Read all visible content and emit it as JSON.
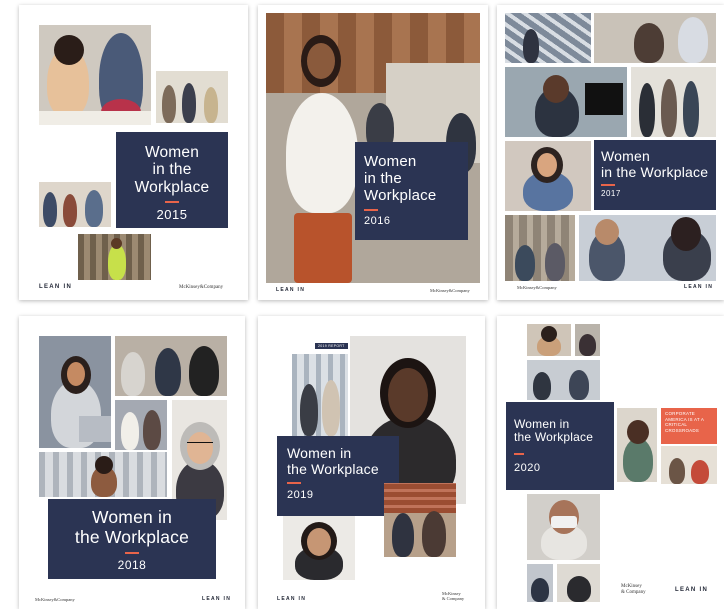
{
  "covers": [
    {
      "title": "Women\nin the\nWorkplace",
      "year": "2015",
      "lean_in": "LEAN IN",
      "mckinsey": "McKinsey&Company"
    },
    {
      "title": "Women\nin the\nWorkplace",
      "year": "2016",
      "lean_in": "LEAN IN",
      "mckinsey": "McKinsey&Company"
    },
    {
      "title": "Women\nin the Workplace",
      "year": "2017",
      "lean_in": "LEAN IN",
      "mckinsey": "McKinsey&Company"
    },
    {
      "title": "Women in\nthe Workplace",
      "year": "2018",
      "lean_in": "LEAN IN",
      "mckinsey": "McKinsey&Company"
    },
    {
      "title": "Women in\nthe Workplace",
      "year": "2019",
      "lean_in": "LEAN IN",
      "mckinsey": "McKinsey\n& Company",
      "tag": "2019 REPORT"
    },
    {
      "title": "Women in\nthe Workplace",
      "year": "2020",
      "lean_in": "LEAN IN",
      "mckinsey": "McKinsey\n& Company",
      "tag": "CORPORATE AMERICA IS AT A CRITICAL CROSSROADS"
    }
  ],
  "colors": {
    "navy": "#2b3453",
    "accent": "#e8644a"
  }
}
